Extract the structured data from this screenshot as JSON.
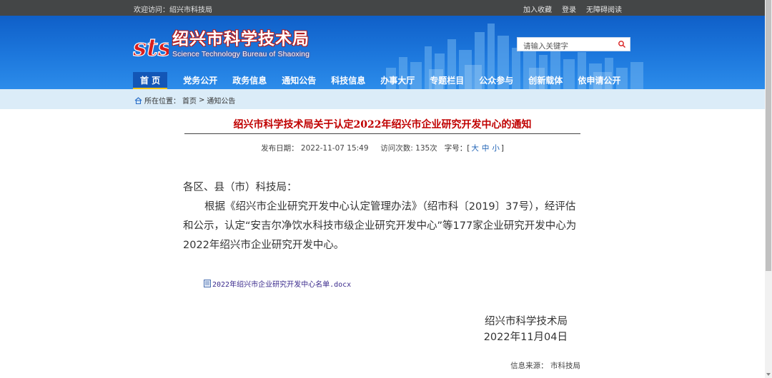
{
  "topbar": {
    "welcome": "欢迎访问：绍兴市科技局",
    "links": [
      "加入收藏",
      "登录",
      "无障碍阅读"
    ]
  },
  "header": {
    "logo_mark": "sts",
    "site_name": "绍兴市科学技术局",
    "site_name_en": "Science Technology Bureau of Shaoxing",
    "search_placeholder": "请输入关键字",
    "brand_color": "#1d78dd",
    "accent_color": "#c00000"
  },
  "nav": [
    {
      "label": "首 页",
      "active": true
    },
    {
      "label": "党务公开"
    },
    {
      "label": "政务信息"
    },
    {
      "label": "通知公告"
    },
    {
      "label": "科技信息"
    },
    {
      "label": "办事大厅"
    },
    {
      "label": "专题栏目"
    },
    {
      "label": "公众参与"
    },
    {
      "label": "创新载体"
    },
    {
      "label": "依申请公开"
    }
  ],
  "breadcrumb": {
    "prefix": "所在位置：",
    "home": "首页",
    "sep": ">",
    "current": "通知公告"
  },
  "article": {
    "title": "绍兴市科学技术局关于认定2022年绍兴市企业研究开发中心的通知",
    "publish_label": "发布日期：",
    "publish_date": "2022-11-07 15:49",
    "visits_label": "访问次数:",
    "visits": "135次",
    "fontsize_label": "字号：[",
    "fontsize_options": [
      "大",
      "中",
      "小"
    ],
    "fontsize_close": "]",
    "salutation": "各区、县（市）科技局：",
    "paragraph": "根据《绍兴市企业研究开发中心认定管理办法》（绍市科〔2019〕37号），经评估和公示，认定“安吉尔净饮水科技市级企业研究开发中心”等177家企业研究开发中心为2022年绍兴市企业研究开发中心。",
    "attachment": "2022年绍兴市企业研究开发中心名单.docx",
    "signature_org": "绍兴市科学技术局",
    "signature_date": "2022年11月04日",
    "source_label": "信息来源：",
    "source": "市科技局"
  }
}
